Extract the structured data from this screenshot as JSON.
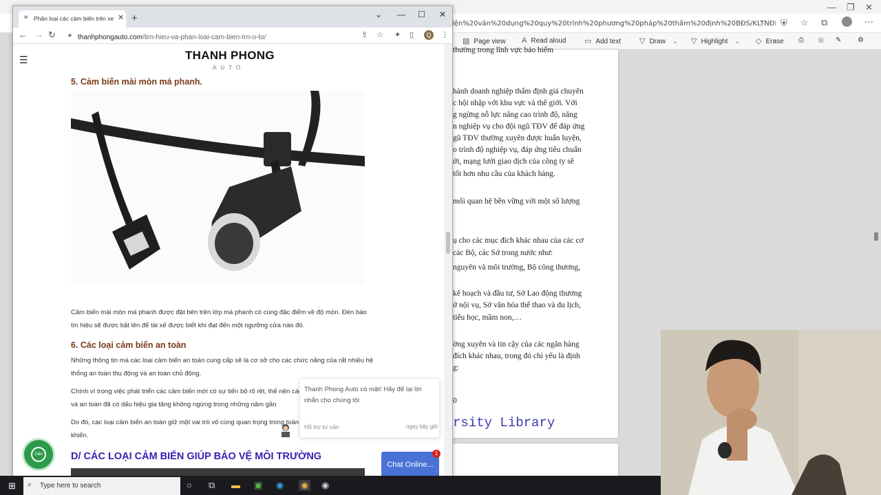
{
  "edge": {
    "url": "iện%20vân%20dụng%20quy%20trình%20phương%20pháp%20thẩm%20định%20BĐS/KLTNĐH%20-%20Hoàn...",
    "toolbar": {
      "page_view": "Page view",
      "read_aloud": "Read aloud",
      "add_text": "Add text",
      "draw": "Draw",
      "highlight": "Highlight",
      "erase": "Erase"
    },
    "pdf_lines": [
      "thường trong lĩnh vực bảo hiểm",
      "hành doanh nghiệp thẩm định giá chuyên",
      "c hội nhập với khu vực và thế giới. Với",
      "g ngừng nỗ lực nâng cao trình độ, năng",
      "n nghiệp vụ cho đội ngũ TĐV để đáp ứng",
      "gũ TĐV thường xuyên được huấn luyện,",
      "o trình độ nghiệp vụ, đáp ứng tiêu chuẩn",
      "ới, mạng lưới giao dịch của công ty sẽ",
      "tốt hơn nhu cầu của khách hàng.",
      "mối quan hệ bền vững với một số lượng",
      "ụ cho các mục đích khác nhau của các cơ",
      "các Bộ, các Sở trong nước như:",
      "nguyên và môi trường, Bộ công thương,",
      "kế hoạch và đầu tư, Sở Lao động thương",
      "ở nội vụ, Sở văn hóa thể thao và du lịch,",
      "tiểu học, mầm non,…",
      "ờng xuyên và tin cậy của các ngân hàng",
      "đích khác nhau, trong đó chỉ yếu là định",
      "g:",
      "0"
    ],
    "library_text": "rsity Library"
  },
  "chrome": {
    "tab_title": "Phân loại các cảm biến trên xe Ô",
    "url_host": "thanhphongauto.com",
    "url_path": "/tim-hieu-va-phan-loai-cam-bien-trn-o-to/",
    "avatar_letter": "Q"
  },
  "site": {
    "name": "THANH PHONG",
    "tagline": "AUTO"
  },
  "article": {
    "heading5": "5. Cảm biến mài mòn má phanh.",
    "para5": "Cảm biến mài mòn má phanh được đặt bên trên lớp má phanh có cùng đặc điểm về độ mòn. Đèn báo tín hiệu sẽ được bật lên để tài xế được biết khi đạt đến một ngưỡng cửa nào đó.",
    "heading6": "6. Các loại cảm biến an toàn",
    "para6a": "Những thông tin mà các loại cảm biến an toàn cung cấp sẽ là cơ sở cho các chức năng của rất nhiều hệ thống an toàn thụ động và an toàn chủ động.",
    "para6b": "Chính vì trong việc phát triển các cảm biến mới có sự tiến bộ rõ rệt, thế nên các hệ thống hỗ trợ tài xế và an toàn đã có dấu hiệu gia tăng không ngừng trong những năm gần",
    "para6c": "Do đó, các loại cảm biến an toàn giữ một vai trò vô cùng quan trọng trong toàn cho những người điều khiển.",
    "section_d": "D/ CÁC LOẠI CẢM BIẾN GIÚP BẢO VỆ MÔI TRƯỜNG"
  },
  "chat": {
    "message": "Thanh Phong Auto có mặt! Hãy để lại lời nhắn cho chúng tôi",
    "agent": "Hỗ trợ tư vấn",
    "time": "ngay bây giờ",
    "button_label": "Chat Online...",
    "badge": "1",
    "zalo_label": "Zalo"
  },
  "taskbar": {
    "search_placeholder": "Type here to search"
  }
}
